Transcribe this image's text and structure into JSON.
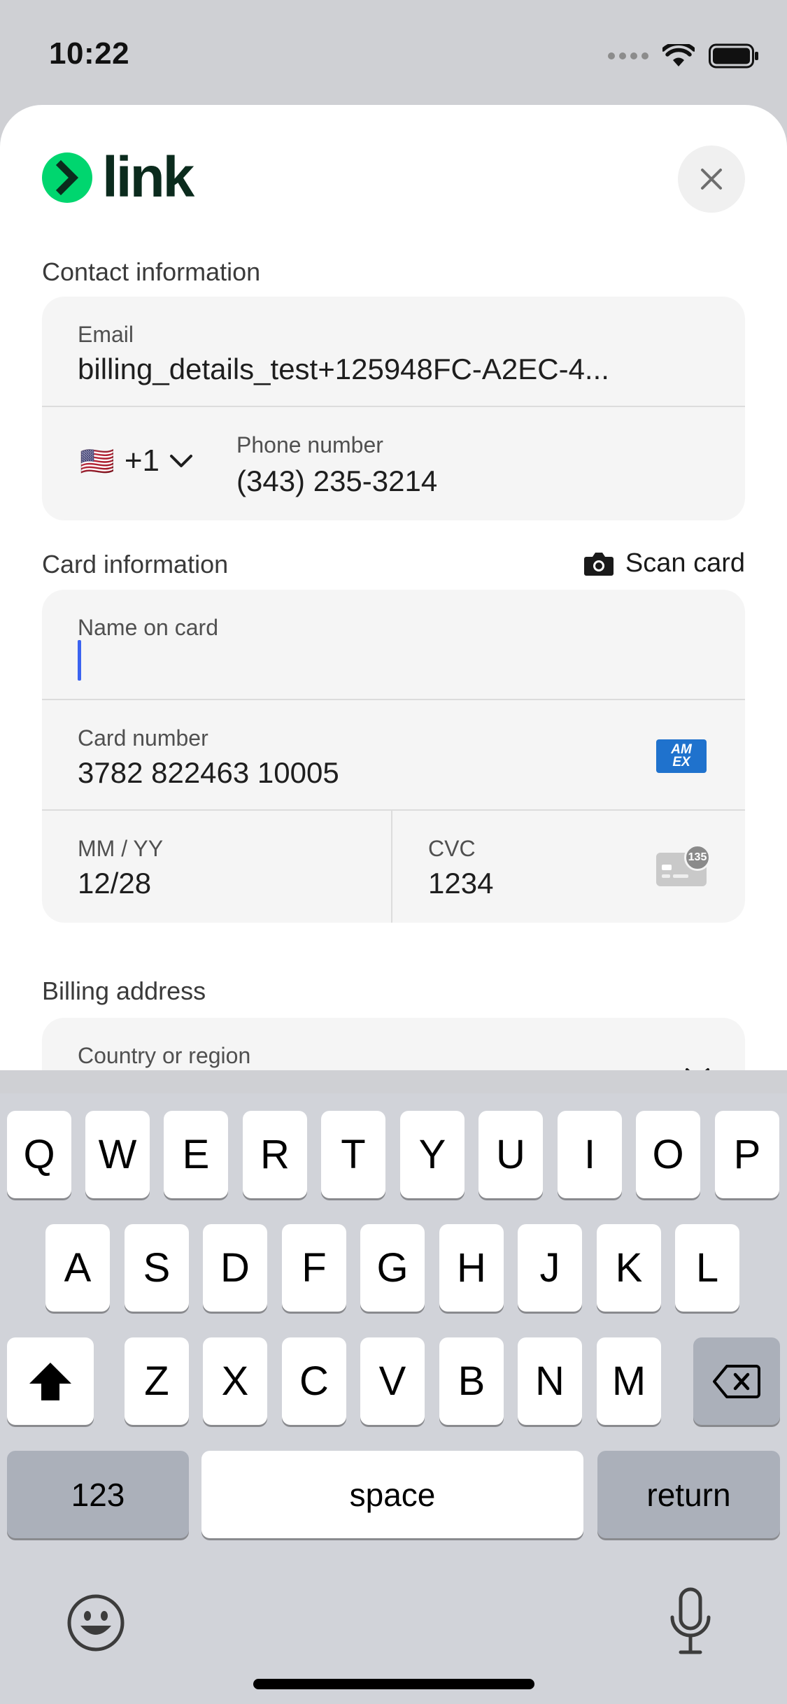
{
  "status_bar": {
    "time": "10:22"
  },
  "header": {
    "brand": "link"
  },
  "contact": {
    "section_label": "Contact information",
    "email_label": "Email",
    "email_value": "billing_details_test+125948FC-A2EC-4...",
    "country_flag": "🇺🇸",
    "country_code": "+1",
    "phone_label": "Phone number",
    "phone_value": "(343) 235-3214"
  },
  "card": {
    "section_label": "Card information",
    "scan_label": "Scan card",
    "name_label": "Name on card",
    "name_value": "",
    "number_label": "Card number",
    "number_value": "3782 822463 10005",
    "brand_badge": "AM EX",
    "expiry_label": "MM / YY",
    "expiry_value": "12/28",
    "cvc_label": "CVC",
    "cvc_value": "1234",
    "cvc_hint_badge": "135"
  },
  "billing": {
    "section_label": "Billing address",
    "country_label": "Country or region"
  },
  "keyboard": {
    "row1": [
      "Q",
      "W",
      "E",
      "R",
      "T",
      "Y",
      "U",
      "I",
      "O",
      "P"
    ],
    "row2": [
      "A",
      "S",
      "D",
      "F",
      "G",
      "H",
      "J",
      "K",
      "L"
    ],
    "row3": [
      "Z",
      "X",
      "C",
      "V",
      "B",
      "N",
      "M"
    ],
    "numbers_key": "123",
    "space_key": "space",
    "return_key": "return"
  },
  "colors": {
    "brand_green": "#00d66f",
    "caret_blue": "#3b63f0",
    "amex_blue": "#1f72cd"
  }
}
